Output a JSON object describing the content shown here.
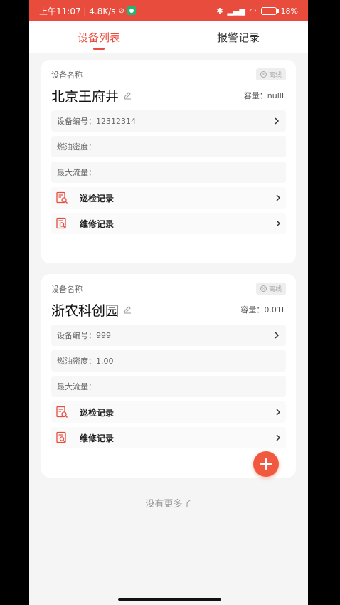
{
  "status_bar": {
    "time_speed": "上午11:07 | 4.8K/s",
    "battery": "18%"
  },
  "tabs": [
    {
      "label": "设备列表",
      "active": true
    },
    {
      "label": "报警记录",
      "active": false
    }
  ],
  "devices": [
    {
      "field_label": "设备名称",
      "name": "北京王府井",
      "status": "离线",
      "capacity": "容量：nullL",
      "device_no": "设备编号：12312314",
      "oil_density": "燃油密度：",
      "max_flow": "最大流量：",
      "patrol_label": "巡检记录",
      "repair_label": "维修记录"
    },
    {
      "field_label": "设备名称",
      "name": "浙农科创园",
      "status": "离线",
      "capacity": "容量：0.01L",
      "device_no": "设备编号：999",
      "oil_density": "燃油密度：1.00",
      "max_flow": "最大流量：",
      "patrol_label": "巡检记录",
      "repair_label": "维修记录"
    }
  ],
  "footer": {
    "end_text": "没有更多了"
  },
  "colors": {
    "accent": "#e84c3d",
    "fab": "#f0583f"
  },
  "icons": [
    "edit-icon",
    "chevron-right-icon",
    "patrol-record-icon",
    "repair-record-icon",
    "plus-icon",
    "offline-icon"
  ]
}
